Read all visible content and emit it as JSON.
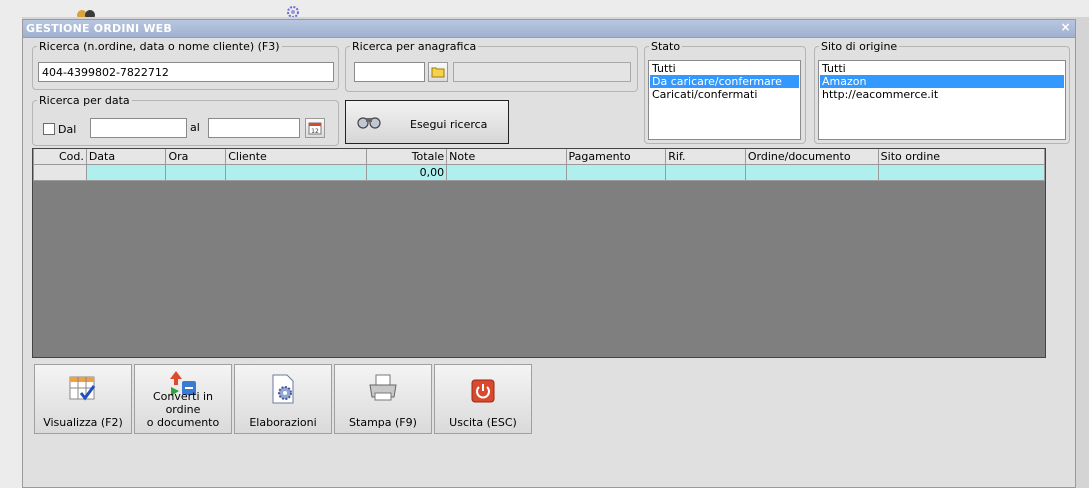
{
  "window": {
    "title": "GESTIONE ORDINI WEB",
    "close_glyph": "×"
  },
  "search_order": {
    "legend": "Ricerca (n.ordine, data o nome cliente) (F3)",
    "value": "404-4399802-7822712"
  },
  "search_registry": {
    "legend": "Ricerca per anagrafica",
    "code_value": "",
    "desc_value": ""
  },
  "search_date": {
    "legend": "Ricerca per data",
    "from_label": "Dal",
    "to_label": "al",
    "from_value": "",
    "to_value": "",
    "from_checked": false
  },
  "search_button": {
    "label": "Esegui ricerca"
  },
  "status": {
    "legend": "Stato",
    "options": [
      "Tutti",
      "Da caricare/confermare",
      "Caricati/confermati"
    ],
    "selected": "Da caricare/confermare"
  },
  "origin": {
    "legend": "Sito di origine",
    "options": [
      "Tutti",
      "Amazon",
      "http://eacommerce.it"
    ],
    "selected": "Amazon"
  },
  "grid": {
    "columns": [
      "Cod.",
      "Data",
      "Ora",
      "Cliente",
      "Totale",
      "Note",
      "Pagamento",
      "Rif.",
      "Ordine/documento",
      "Sito ordine"
    ],
    "rows": [
      [
        "",
        "",
        "",
        "",
        "0,00",
        "",
        "",
        "",
        "",
        ""
      ]
    ]
  },
  "toolbar": {
    "view_label": "Visualizza (F2)",
    "convert_label_1": "Converti in ordine",
    "convert_label_2": "o documento",
    "process_label": "Elaborazioni",
    "print_label": "Stampa (F9)",
    "exit_label": "Uscita (ESC)"
  },
  "icons": {
    "close": "close-icon",
    "folder": "folder-icon",
    "calendar": "calendar-icon",
    "binoculars": "binoculars-icon",
    "view": "grid-check-icon",
    "convert": "convert-arrows-icon",
    "process": "document-gear-icon",
    "print": "printer-icon",
    "exit": "power-icon"
  },
  "colors": {
    "titlebar": "#9fb1d0",
    "selection": "#3399ff",
    "grid_row": "#aff0ee",
    "grid_bg": "#7f7f7f",
    "exit_red": "#d84a2e"
  }
}
